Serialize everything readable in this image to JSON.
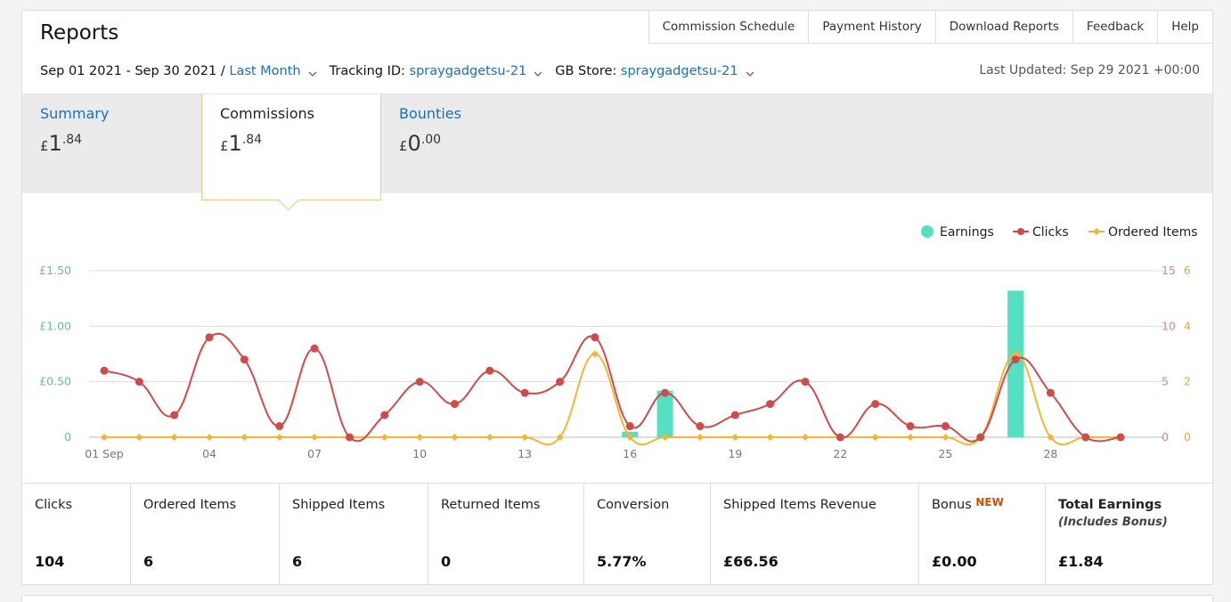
{
  "header": {
    "title": "Reports",
    "nav": [
      "Commission Schedule",
      "Payment History",
      "Download Reports",
      "Feedback",
      "Help"
    ]
  },
  "filters": {
    "date_range": "Sep 01 2021 - Sep 30 2021 /",
    "period": "Last Month",
    "tracking_label": "Tracking ID:",
    "tracking_id": "spraygadgetsu-21",
    "store_label": "GB Store:",
    "store_id": "spraygadgetsu-21",
    "last_updated": "Last Updated: Sep 29 2021 +00:00"
  },
  "tabs": [
    {
      "label": "Summary",
      "currency": "£",
      "whole": "1",
      "fraction": ".84"
    },
    {
      "label": "Commissions",
      "currency": "£",
      "whole": "1",
      "fraction": ".84"
    },
    {
      "label": "Bounties",
      "currency": "£",
      "whole": "0",
      "fraction": ".00"
    }
  ],
  "chart_data": {
    "type": "line",
    "legend": [
      "Earnings",
      "Clicks",
      "Ordered Items"
    ],
    "legend_position": "top-right",
    "colors": {
      "earnings": "#55e0c4",
      "clicks": "#cf4b4b",
      "ordered": "#f2b634"
    },
    "x_ticks": [
      "01 Sep",
      "04",
      "07",
      "10",
      "13",
      "16",
      "19",
      "22",
      "25",
      "28"
    ],
    "y_left_ticks": [
      "£1.50",
      "£1.00",
      "£0.50",
      "0"
    ],
    "y_right_clicks_ticks": [
      "15",
      "10",
      "5",
      "0"
    ],
    "y_right_items_ticks": [
      "6",
      "4",
      "2",
      "0"
    ],
    "ylim_earnings": [
      0,
      1.5
    ],
    "ylim_clicks": [
      0,
      15
    ],
    "ylim_items": [
      0,
      6
    ],
    "days": [
      1,
      2,
      3,
      4,
      5,
      6,
      7,
      8,
      9,
      10,
      11,
      12,
      13,
      14,
      15,
      16,
      17,
      18,
      19,
      20,
      21,
      22,
      23,
      24,
      25,
      26,
      27,
      28,
      29,
      30
    ],
    "series": [
      {
        "name": "Earnings",
        "values": [
          0,
          0,
          0,
          0,
          0,
          0,
          0,
          0,
          0,
          0,
          0,
          0,
          0,
          0,
          0,
          0.05,
          0.42,
          0,
          0,
          0,
          0,
          0,
          0,
          0,
          0,
          0,
          1.32,
          0,
          0,
          0
        ]
      },
      {
        "name": "Clicks",
        "values": [
          6,
          5,
          2,
          9,
          7,
          1,
          8,
          0,
          2,
          5,
          3,
          6,
          4,
          5,
          9,
          1,
          4,
          1,
          2,
          3,
          5,
          0,
          3,
          1,
          1,
          0,
          7,
          4,
          0,
          0
        ]
      },
      {
        "name": "Ordered Items",
        "values": [
          0,
          0,
          0,
          0,
          0,
          0,
          0,
          0,
          0,
          0,
          0,
          0,
          0,
          0,
          3,
          0,
          0,
          0,
          0,
          0,
          0,
          0,
          0,
          0,
          0,
          0,
          3,
          0,
          0,
          0
        ]
      }
    ],
    "grid": true
  },
  "stats": [
    {
      "label": "Clicks",
      "value": "104"
    },
    {
      "label": "Ordered Items",
      "value": "6"
    },
    {
      "label": "Shipped Items",
      "value": "6"
    },
    {
      "label": "Returned Items",
      "value": "0"
    },
    {
      "label": "Conversion",
      "value": "5.77%"
    },
    {
      "label": "Shipped Items Revenue",
      "value": "£66.56"
    },
    {
      "label": "Bonus",
      "badge": "NEW",
      "value": "£0.00"
    },
    {
      "label": "Total Earnings",
      "sub": "(Includes Bonus)",
      "value": "£1.84"
    }
  ]
}
